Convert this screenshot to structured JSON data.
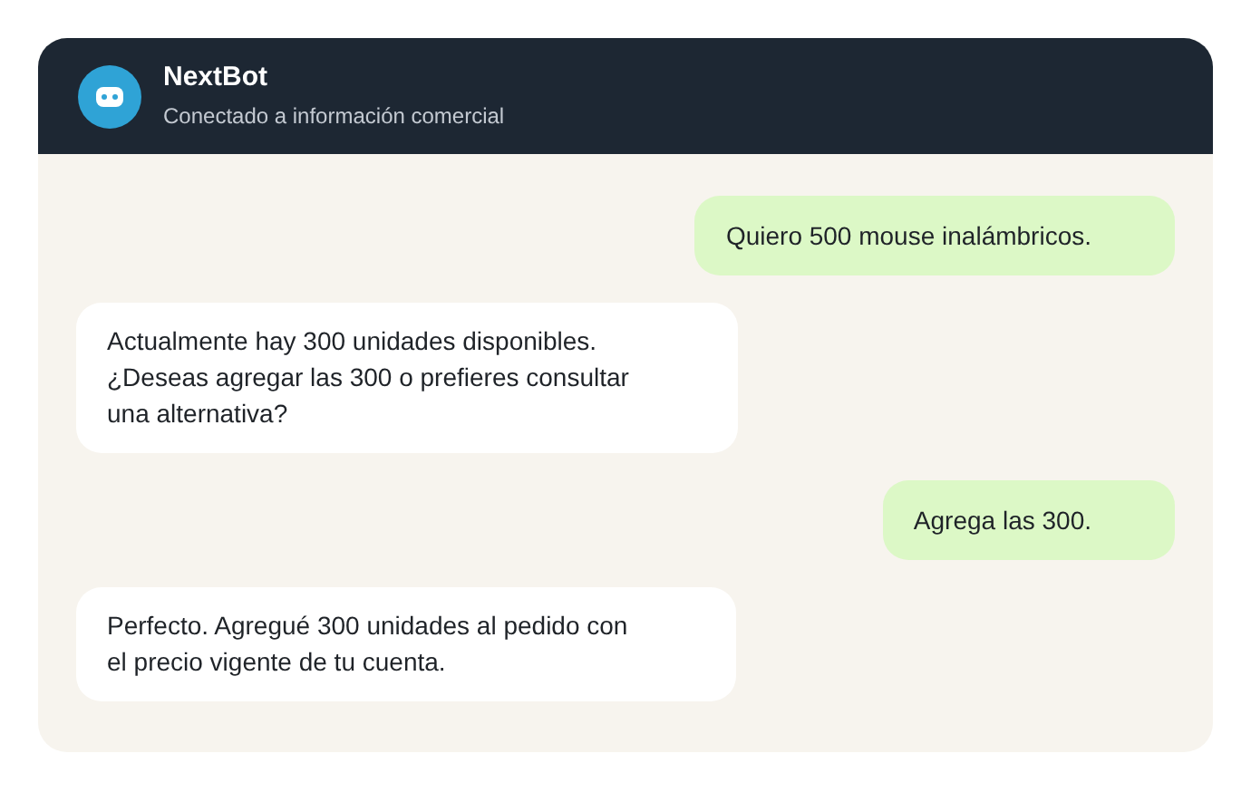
{
  "header": {
    "title": "NextBot",
    "subtitle": "Conectado a información comercial"
  },
  "messages": [
    {
      "kind": "user",
      "text": "Quiero 500 mouse inalámbricos."
    },
    {
      "kind": "bot",
      "text": "Actualmente hay 300 unidades disponibles.\n¿Deseas agregar las 300 o prefieres consultar\nuna alternativa?"
    },
    {
      "kind": "user",
      "text": "Agrega las 300."
    },
    {
      "kind": "bot",
      "text": "Perfecto. Agregué 300 unidades al pedido con\nel precio vigente de tu cuenta."
    }
  ]
}
